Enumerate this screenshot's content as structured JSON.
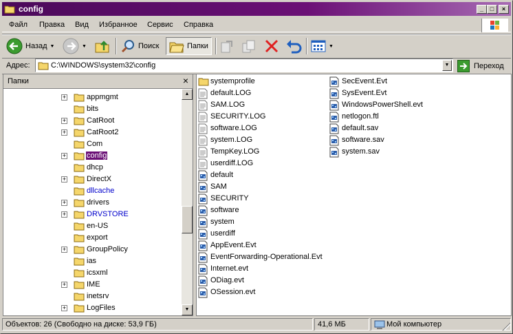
{
  "window": {
    "title": "config"
  },
  "menu": [
    "Файл",
    "Правка",
    "Вид",
    "Избранное",
    "Сервис",
    "Справка"
  ],
  "toolbar": {
    "back": "Назад",
    "search": "Поиск",
    "folders": "Папки"
  },
  "address": {
    "label": "Адрес:",
    "path": "C:\\WINDOWS\\system32\\config",
    "go": "Переход"
  },
  "folders_pane": {
    "title": "Папки",
    "items": [
      {
        "label": "appmgmt",
        "expand": "+"
      },
      {
        "label": "bits",
        "expand": ""
      },
      {
        "label": "CatRoot",
        "expand": "+"
      },
      {
        "label": "CatRoot2",
        "expand": "+"
      },
      {
        "label": "Com",
        "expand": ""
      },
      {
        "label": "config",
        "expand": "+",
        "selected": true
      },
      {
        "label": "dhcp",
        "expand": ""
      },
      {
        "label": "DirectX",
        "expand": "+"
      },
      {
        "label": "dllcache",
        "expand": "",
        "blue": true
      },
      {
        "label": "drivers",
        "expand": "+"
      },
      {
        "label": "DRVSTORE",
        "expand": "+",
        "blue": true
      },
      {
        "label": "en-US",
        "expand": ""
      },
      {
        "label": "export",
        "expand": ""
      },
      {
        "label": "GroupPolicy",
        "expand": "+"
      },
      {
        "label": "ias",
        "expand": ""
      },
      {
        "label": "icsxml",
        "expand": ""
      },
      {
        "label": "IME",
        "expand": "+"
      },
      {
        "label": "inetsrv",
        "expand": ""
      },
      {
        "label": "LogFiles",
        "expand": "+"
      }
    ]
  },
  "files": {
    "col1": [
      {
        "name": "systemprofile",
        "icon": "folder"
      },
      {
        "name": "default.LOG",
        "icon": "text"
      },
      {
        "name": "SAM.LOG",
        "icon": "text"
      },
      {
        "name": "SECURITY.LOG",
        "icon": "text"
      },
      {
        "name": "software.LOG",
        "icon": "text"
      },
      {
        "name": "system.LOG",
        "icon": "text"
      },
      {
        "name": "TempKey.LOG",
        "icon": "text"
      },
      {
        "name": "userdiff.LOG",
        "icon": "text"
      },
      {
        "name": "default",
        "icon": "sys"
      },
      {
        "name": "SAM",
        "icon": "sys"
      },
      {
        "name": "SECURITY",
        "icon": "sys"
      },
      {
        "name": "software",
        "icon": "sys"
      },
      {
        "name": "system",
        "icon": "sys"
      },
      {
        "name": "userdiff",
        "icon": "sys"
      },
      {
        "name": "AppEvent.Evt",
        "icon": "sys"
      },
      {
        "name": "EventForwarding-Operational.Evt",
        "icon": "sys"
      },
      {
        "name": "Internet.evt",
        "icon": "sys"
      },
      {
        "name": "ODiag.evt",
        "icon": "sys"
      },
      {
        "name": "OSession.evt",
        "icon": "sys"
      }
    ],
    "col2": [
      {
        "name": "SecEvent.Evt",
        "icon": "sys"
      },
      {
        "name": "SysEvent.Evt",
        "icon": "sys"
      },
      {
        "name": "WindowsPowerShell.evt",
        "icon": "sys"
      },
      {
        "name": "netlogon.ftl",
        "icon": "sys"
      },
      {
        "name": "default.sav",
        "icon": "sys"
      },
      {
        "name": "software.sav",
        "icon": "sys"
      },
      {
        "name": "system.sav",
        "icon": "sys"
      }
    ]
  },
  "status": {
    "objects": "Объектов: 26 (Свободно на диске: 53,9 ГБ)",
    "size": "41,6 МБ",
    "location": "Мой компьютер"
  }
}
